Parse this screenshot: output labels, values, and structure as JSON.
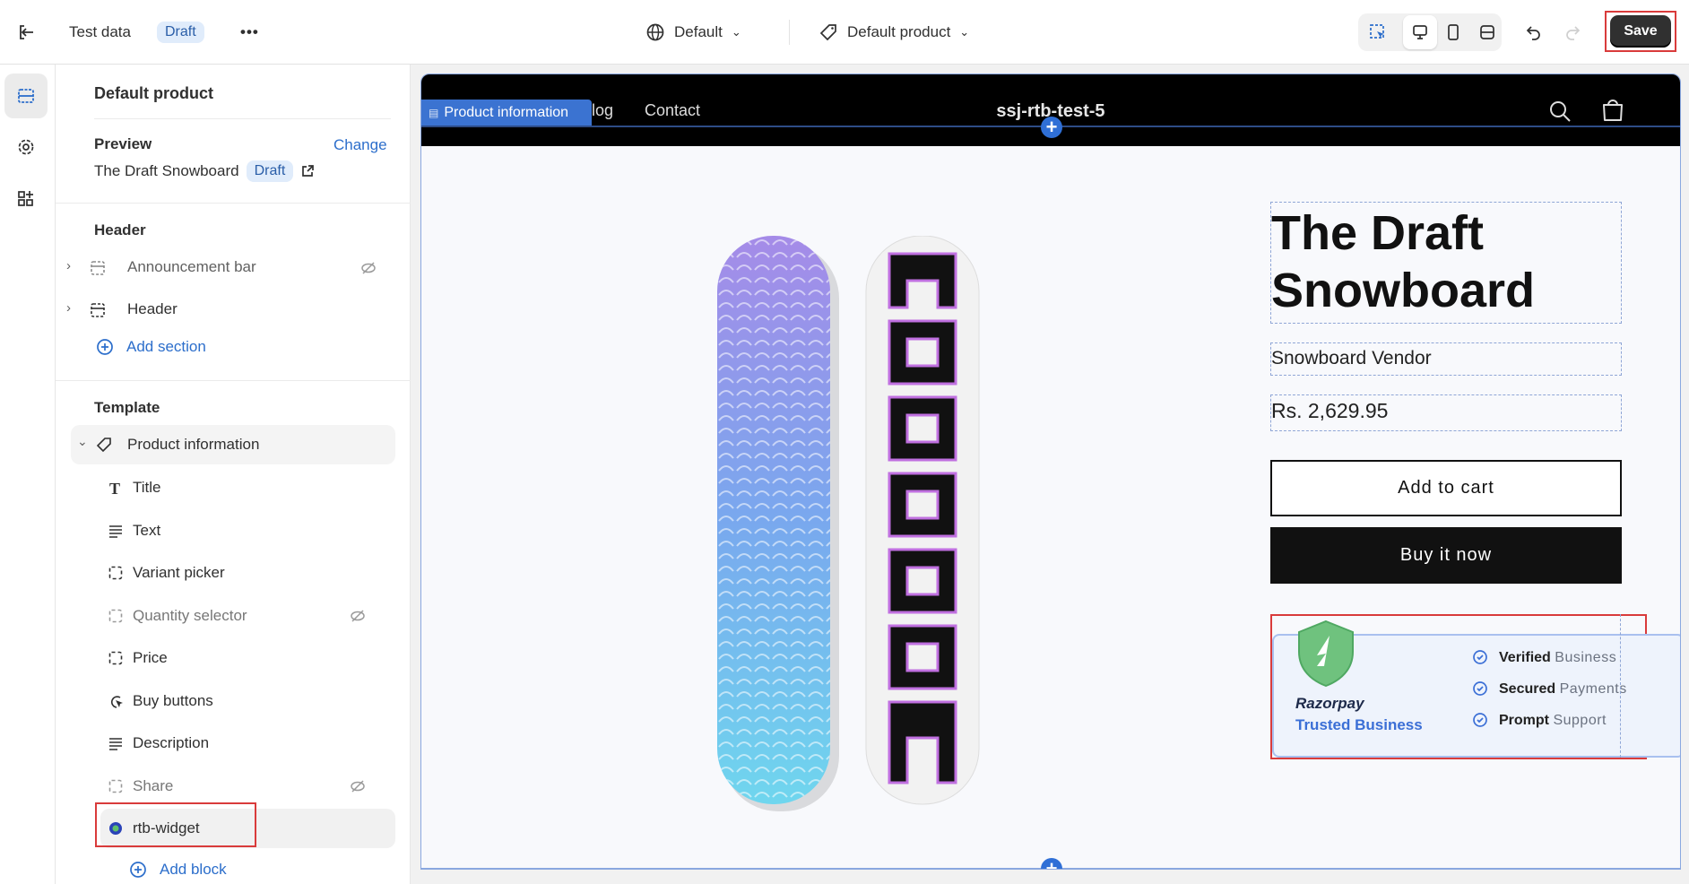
{
  "topbar": {
    "back_icon": "exit-icon",
    "store_name": "Test data",
    "status": "Draft",
    "more": "•••",
    "language": "Default",
    "template": "Default product",
    "save": "Save"
  },
  "rail": {
    "items": [
      "sections-icon",
      "settings-icon",
      "apps-icon"
    ]
  },
  "sidebar": {
    "title": "Default product",
    "preview_label": "Preview",
    "change": "Change",
    "preview_product": "The Draft Snowboard",
    "preview_status": "Draft",
    "header_group": "Header",
    "header_items": [
      {
        "label": "Announcement bar",
        "hidden": true
      },
      {
        "label": "Header",
        "hidden": false
      }
    ],
    "add_section": "Add section",
    "template_group": "Template",
    "section": "Product information",
    "blocks": [
      {
        "label": "Title",
        "icon": "title-icon",
        "hidden": false
      },
      {
        "label": "Text",
        "icon": "text-icon",
        "hidden": false
      },
      {
        "label": "Variant picker",
        "icon": "block-icon",
        "hidden": false
      },
      {
        "label": "Quantity selector",
        "icon": "block-icon",
        "hidden": true
      },
      {
        "label": "Price",
        "icon": "block-icon",
        "hidden": false
      },
      {
        "label": "Buy buttons",
        "icon": "buy-buttons-icon",
        "hidden": false
      },
      {
        "label": "Description",
        "icon": "text-icon",
        "hidden": false
      },
      {
        "label": "Share",
        "icon": "block-icon",
        "hidden": true
      },
      {
        "label": "rtb-widget",
        "icon": "app-block-icon",
        "hidden": false
      }
    ],
    "add_block": "Add block"
  },
  "store": {
    "section_tag": "Product information",
    "nav": [
      "log",
      "Contact"
    ],
    "store_name": "ssj-rtb-test-5",
    "product": {
      "title": "The Draft Snowboard",
      "vendor": "Snowboard Vendor",
      "price": "Rs. 2,629.95",
      "add_to_cart": "Add to cart",
      "buy_now": "Buy it now"
    },
    "widget": {
      "brand": "Razorpay",
      "tagline": "Trusted Business",
      "features": [
        {
          "strong": "Verified",
          "rest": "Business"
        },
        {
          "strong": "Secured",
          "rest": "Payments"
        },
        {
          "strong": "Prompt",
          "rest": "Support"
        }
      ]
    }
  },
  "colors": {
    "accent": "#2c6ecb",
    "highlight": "#d93b3b",
    "save": "#303030"
  }
}
